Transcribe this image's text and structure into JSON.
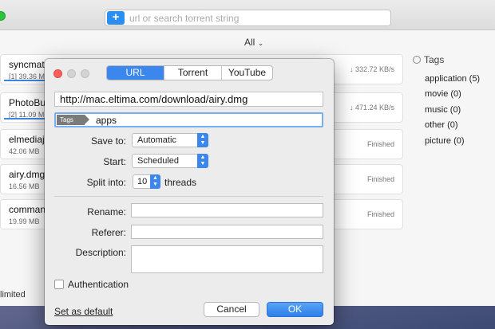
{
  "main": {
    "search_placeholder": "url or search torrent string",
    "plus_label": "+",
    "filter_label": "All",
    "footer_text": "limited",
    "downloads": [
      {
        "name": "syncmat",
        "meta": "[1] 39.36 M",
        "status": "↓ 332.72 KB/s"
      },
      {
        "name": "PhotoBul",
        "meta": "[2] 11.09 M",
        "status": "↓ 471.24 KB/s"
      },
      {
        "name": "elmediaj",
        "meta": "42.06 MB",
        "status": "Finished"
      },
      {
        "name": "airy.dmg",
        "meta": "16.56 MB",
        "status": "Finished"
      },
      {
        "name": "comman",
        "meta": "19.99 MB",
        "status": "Finished"
      }
    ]
  },
  "tags_panel": {
    "title": "Tags",
    "items": [
      {
        "label": "application (5)"
      },
      {
        "label": "movie (0)"
      },
      {
        "label": "music (0)"
      },
      {
        "label": "other (0)"
      },
      {
        "label": "picture (0)"
      }
    ]
  },
  "dialog": {
    "tabs": [
      {
        "label": "URL",
        "active": true
      },
      {
        "label": "Torrent",
        "active": false
      },
      {
        "label": "YouTube",
        "active": false
      }
    ],
    "url_value": "http://mac.eltima.com/download/airy.dmg",
    "tags_chip": "Tags",
    "tags_value": "apps",
    "save_to_label": "Save to:",
    "save_to_value": "Automatic",
    "start_label": "Start:",
    "start_value": "Scheduled",
    "split_label": "Split into:",
    "split_value": "10",
    "threads_label": "threads",
    "rename_label": "Rename:",
    "referer_label": "Referer:",
    "description_label": "Description:",
    "auth_label": "Authentication",
    "set_default_label": "Set as default",
    "cancel_label": "Cancel",
    "ok_label": "OK"
  },
  "colors": {
    "accent": "#3c87ee",
    "close_red": "#fc5f57",
    "maximize_green": "#2dc43b"
  }
}
